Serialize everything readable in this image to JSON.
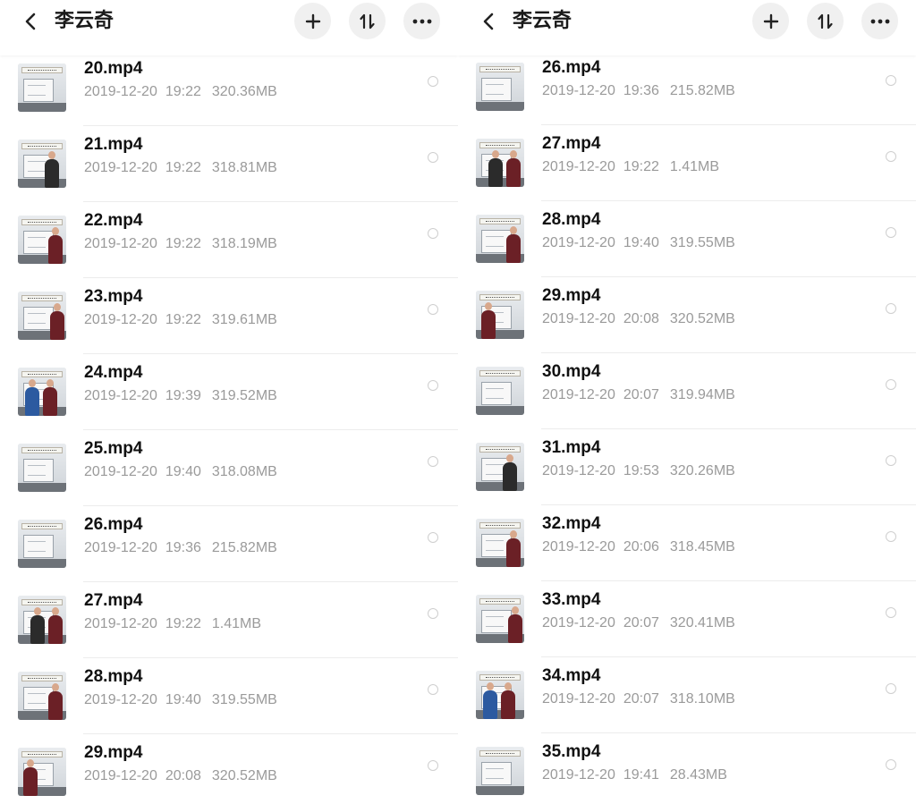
{
  "panes": [
    {
      "header": {
        "title": "李云奇",
        "back_icon": "chevron-left-icon",
        "add_icon": "plus-icon",
        "sort_icon": "sort-icon",
        "more_icon": "more-dots-icon"
      },
      "files": [
        {
          "name": "20.mp4",
          "date": "2019-12-20",
          "time": "19:22",
          "size": "320.36MB"
        },
        {
          "name": "21.mp4",
          "date": "2019-12-20",
          "time": "19:22",
          "size": "318.81MB"
        },
        {
          "name": "22.mp4",
          "date": "2019-12-20",
          "time": "19:22",
          "size": "318.19MB"
        },
        {
          "name": "23.mp4",
          "date": "2019-12-20",
          "time": "19:22",
          "size": "319.61MB"
        },
        {
          "name": "24.mp4",
          "date": "2019-12-20",
          "time": "19:39",
          "size": "319.52MB"
        },
        {
          "name": "25.mp4",
          "date": "2019-12-20",
          "time": "19:40",
          "size": "318.08MB"
        },
        {
          "name": "26.mp4",
          "date": "2019-12-20",
          "time": "19:36",
          "size": "215.82MB"
        },
        {
          "name": "27.mp4",
          "date": "2019-12-20",
          "time": "19:22",
          "size": "1.41MB"
        },
        {
          "name": "28.mp4",
          "date": "2019-12-20",
          "time": "19:40",
          "size": "319.55MB"
        },
        {
          "name": "29.mp4",
          "date": "2019-12-20",
          "time": "20:08",
          "size": "320.52MB"
        }
      ]
    },
    {
      "header": {
        "title": "李云奇",
        "back_icon": "chevron-left-icon",
        "add_icon": "plus-icon",
        "sort_icon": "sort-icon",
        "more_icon": "more-dots-icon"
      },
      "files": [
        {
          "name": "26.mp4",
          "date": "2019-12-20",
          "time": "19:36",
          "size": "215.82MB"
        },
        {
          "name": "27.mp4",
          "date": "2019-12-20",
          "time": "19:22",
          "size": "1.41MB"
        },
        {
          "name": "28.mp4",
          "date": "2019-12-20",
          "time": "19:40",
          "size": "319.55MB"
        },
        {
          "name": "29.mp4",
          "date": "2019-12-20",
          "time": "20:08",
          "size": "320.52MB"
        },
        {
          "name": "30.mp4",
          "date": "2019-12-20",
          "time": "20:07",
          "size": "319.94MB"
        },
        {
          "name": "31.mp4",
          "date": "2019-12-20",
          "time": "19:53",
          "size": "320.26MB"
        },
        {
          "name": "32.mp4",
          "date": "2019-12-20",
          "time": "20:06",
          "size": "318.45MB"
        },
        {
          "name": "33.mp4",
          "date": "2019-12-20",
          "time": "20:07",
          "size": "320.41MB"
        },
        {
          "name": "34.mp4",
          "date": "2019-12-20",
          "time": "20:07",
          "size": "318.10MB"
        },
        {
          "name": "35.mp4",
          "date": "2019-12-20",
          "time": "19:41",
          "size": "28.43MB"
        }
      ]
    }
  ],
  "colors": {
    "text_primary": "#111111",
    "text_secondary": "#9a9a9a",
    "button_bg": "#f0f0f0",
    "divider": "#ececec"
  }
}
